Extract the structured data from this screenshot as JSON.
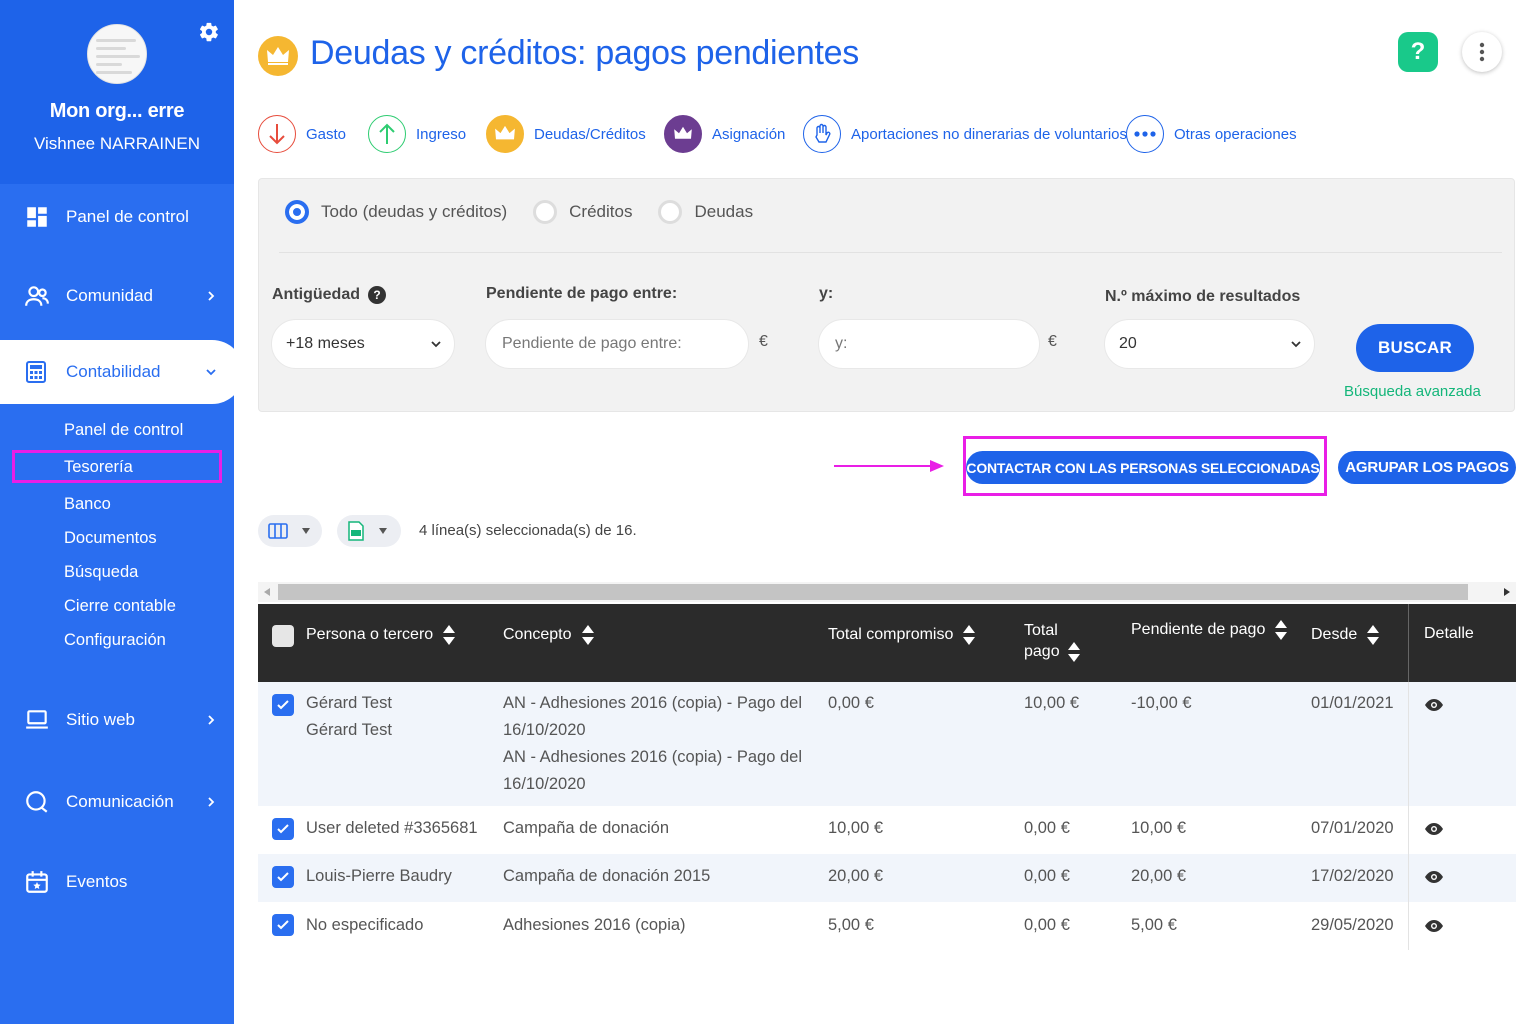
{
  "sidebar": {
    "org_name": "Mon org... erre",
    "user_name": "Vishnee NARRAINEN",
    "items": [
      {
        "label": "Panel de control",
        "icon": "dashboard-icon"
      },
      {
        "label": "Comunidad",
        "icon": "people-icon"
      },
      {
        "label": "Contabilidad",
        "icon": "calculator-icon",
        "active": true
      },
      {
        "label": "Sitio web",
        "icon": "laptop-icon"
      },
      {
        "label": "Comunicación",
        "icon": "chat-icon"
      },
      {
        "label": "Eventos",
        "icon": "calendar-icon"
      }
    ],
    "sub_items": [
      "Panel de control",
      "Tesorería",
      "Banco",
      "Documentos",
      "Búsqueda",
      "Cierre contable",
      "Configuración"
    ],
    "highlighted_sub_item": "Tesorería"
  },
  "header": {
    "title": "Deudas y créditos: pagos pendientes",
    "help_label": "?"
  },
  "operations": [
    {
      "label": "Gasto",
      "icon": "arrow-down-icon",
      "color": "#e74c3c"
    },
    {
      "label": "Ingreso",
      "icon": "arrow-up-icon",
      "color": "#2ecc71"
    },
    {
      "label": "Deudas/Créditos",
      "icon": "crown-icon",
      "color": "#f5b731"
    },
    {
      "label": "Asignación",
      "icon": "crown-expand-icon",
      "color": "#6c3d91"
    },
    {
      "label": "Aportaciones no dinerarias de voluntarios",
      "icon": "hand-icon",
      "color": "#1e63e9"
    },
    {
      "label": "Otras operaciones",
      "icon": "dots-icon",
      "color": "#1e63e9"
    }
  ],
  "filters": {
    "radios": [
      {
        "label": "Todo (deudas y créditos)",
        "selected": true
      },
      {
        "label": "Créditos",
        "selected": false
      },
      {
        "label": "Deudas",
        "selected": false
      }
    ],
    "antiguedad": {
      "label": "Antigüedad",
      "value": "+18 meses"
    },
    "pendiente_entre": {
      "label": "Pendiente de pago entre:",
      "placeholder": "Pendiente de pago entre:"
    },
    "y": {
      "label": "y:",
      "placeholder": "y:"
    },
    "currency": "€",
    "max_results": {
      "label": "N.º máximo de resultados",
      "value": "20"
    },
    "search_button": "BUSCAR",
    "advanced_link": "Búsqueda avanzada"
  },
  "actions": {
    "contact_button": "CONTACTAR CON LAS PERSONAS SELECCIONADAS",
    "group_button": "AGRUPAR LOS PAGOS",
    "accent_color": "#e91ee6"
  },
  "selection_text": "4 línea(s) seleccionada(s) de 16.",
  "table": {
    "columns": [
      "Persona o tercero",
      "Concepto",
      "Total compromiso",
      "Total pago",
      "Pendiente de pago",
      "Desde",
      "Detalle"
    ],
    "rows": [
      {
        "persona": [
          "Gérard Test",
          "Gérard Test"
        ],
        "concepto": [
          "AN - Adhesiones 2016 (copia) - Pago del",
          "16/10/2020",
          "AN - Adhesiones 2016 (copia) - Pago del",
          "16/10/2020"
        ],
        "total_compromiso": "0,00 €",
        "total_pago": "10,00 €",
        "pendiente": "-10,00 €",
        "desde": "01/01/2021",
        "checked": true
      },
      {
        "persona": [
          "User deleted #3365681"
        ],
        "concepto": [
          "Campaña de donación"
        ],
        "total_compromiso": "10,00 €",
        "total_pago": "0,00 €",
        "pendiente": "10,00 €",
        "desde": "07/01/2020",
        "checked": true
      },
      {
        "persona": [
          "Louis-Pierre Baudry"
        ],
        "concepto": [
          "Campaña de donación 2015"
        ],
        "total_compromiso": "20,00 €",
        "total_pago": "0,00 €",
        "pendiente": "20,00 €",
        "desde": "17/02/2020",
        "checked": true
      },
      {
        "persona": [
          "No especificado"
        ],
        "concepto": [
          "Adhesiones 2016 (copia)"
        ],
        "total_compromiso": "5,00 €",
        "total_pago": "0,00 €",
        "pendiente": "5,00 €",
        "desde": "29/05/2020",
        "checked": true
      }
    ]
  }
}
